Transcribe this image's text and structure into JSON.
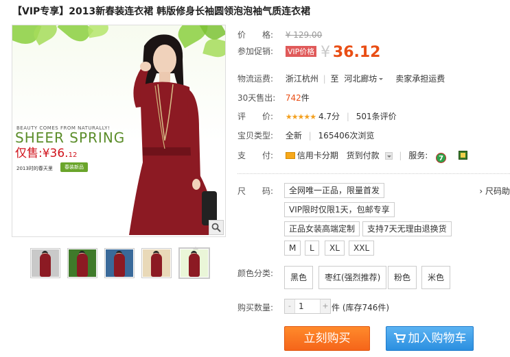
{
  "title": "【VIP专享】2013新春装连衣裙 韩版修身长袖圆领泡泡袖气质连衣裙",
  "gallery": {
    "promo_small": "BEAUTY COMES FROM NATURALLY!",
    "promo_big": "SHEER SPRING",
    "promo_price": "仅售:¥36.",
    "promo_price_small": "12",
    "promo_spring": "2013时的春天里",
    "promo_badge": "春装新品",
    "zoom_icon": "magnifier-icon",
    "thumbnails": [
      {
        "label": "thumb-1",
        "bg": "#c9c9c9"
      },
      {
        "label": "thumb-2",
        "bg": "#3f7a2a"
      },
      {
        "label": "thumb-3",
        "bg": "#3a6a9a"
      },
      {
        "label": "thumb-4",
        "bg": "#e9d9b8"
      },
      {
        "label": "thumb-5",
        "bg": "#eaf6d8"
      }
    ]
  },
  "price": {
    "label": "价　　格:",
    "original": "¥ 129.00"
  },
  "promo": {
    "label": "参加促销:",
    "tag": "VIP价格",
    "currency": "¥",
    "amount": "36.12"
  },
  "shipping": {
    "label": "物流运费:",
    "from": "浙江杭州",
    "to_prefix": "至",
    "to": "河北廊坊",
    "fee": "卖家承担运费"
  },
  "sales": {
    "label": "30天售出:",
    "count": "742",
    "unit": "件"
  },
  "rating": {
    "label": "评　　价:",
    "stars": "★★★★★",
    "score": "4.7分",
    "reviews": "501条评价"
  },
  "item_type": {
    "label": "宝贝类型:",
    "condition": "全新",
    "views": "165406次浏览"
  },
  "payment": {
    "label": "支　　付:",
    "credit": "信用卡分期",
    "cod": "货到付款",
    "service_label": "服务:",
    "service_7": "7"
  },
  "size": {
    "label": "尺　　码:",
    "guide": "› 尺码助",
    "tags": [
      "全网唯一正品，限量首发",
      "VIP限时仅限1天，包邮专享",
      "正品女装高端定制",
      "支持7天无理由退换货"
    ],
    "options": [
      "M",
      "L",
      "XL",
      "XXL"
    ]
  },
  "color": {
    "label": "颜色分类:",
    "options": [
      "黑色",
      "枣红(强烈推荐)",
      "粉色",
      "米色"
    ]
  },
  "quantity": {
    "label": "购买数量:",
    "value": "1",
    "minus": "-",
    "plus": "+",
    "stock": "件 (库存746件)"
  },
  "actions": {
    "buy": "立刻购买",
    "cart": "加入购物车"
  },
  "colors": {
    "accent": "#e94e15",
    "buy": "#f5651a",
    "cart": "#2b8fe0",
    "dress": "#8c1a23"
  }
}
